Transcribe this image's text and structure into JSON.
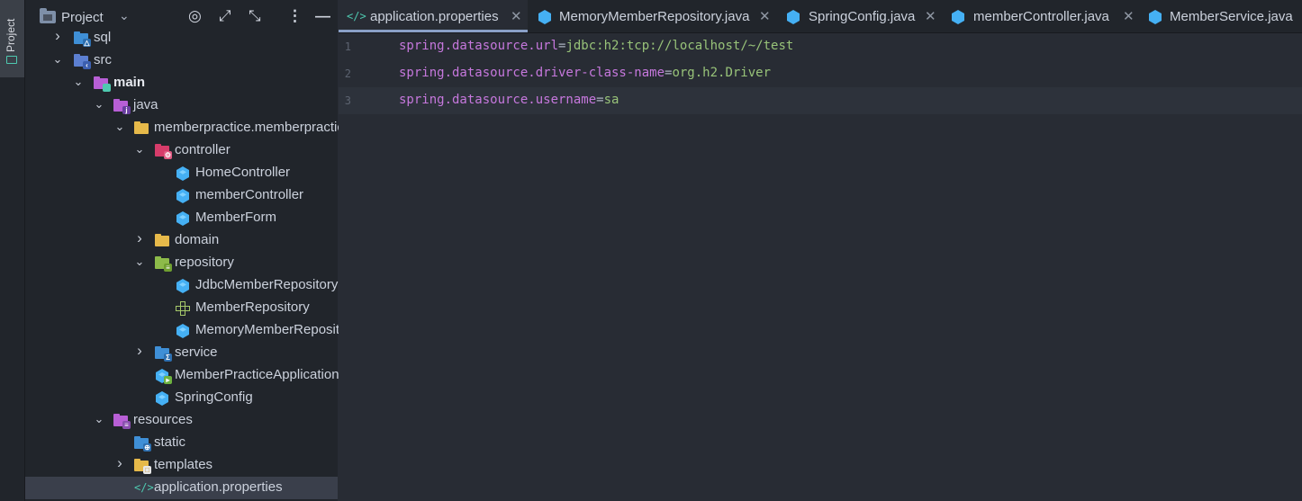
{
  "side_strip": {
    "tab_label": "Project"
  },
  "panel": {
    "title": "Project",
    "tree": [
      {
        "label": "sql",
        "icon": "sql-folder-icon",
        "depth": 1,
        "expanded": false,
        "has_chevron": true
      },
      {
        "label": "src",
        "icon": "source-folder-icon",
        "depth": 1,
        "expanded": true,
        "has_chevron": true
      },
      {
        "label": "main",
        "icon": "module-folder-icon",
        "depth": 2,
        "expanded": true,
        "has_chevron": true,
        "bold": true
      },
      {
        "label": "java",
        "icon": "java-source-folder-icon",
        "depth": 3,
        "expanded": true,
        "has_chevron": true
      },
      {
        "label": "memberpractice.memberpractice",
        "icon": "package-folder-icon",
        "depth": 4,
        "expanded": true,
        "has_chevron": true
      },
      {
        "label": "controller",
        "icon": "controller-package-icon",
        "depth": 5,
        "expanded": true,
        "has_chevron": true
      },
      {
        "label": "HomeController",
        "icon": "java-class-icon",
        "depth": 6,
        "has_chevron": false
      },
      {
        "label": "memberController",
        "icon": "java-class-icon",
        "depth": 6,
        "has_chevron": false
      },
      {
        "label": "MemberForm",
        "icon": "java-class-icon",
        "depth": 6,
        "has_chevron": false
      },
      {
        "label": "domain",
        "icon": "package-folder-icon",
        "depth": 5,
        "expanded": false,
        "has_chevron": true
      },
      {
        "label": "repository",
        "icon": "repository-package-icon",
        "depth": 5,
        "expanded": true,
        "has_chevron": true
      },
      {
        "label": "JdbcMemberRepository",
        "icon": "java-class-icon",
        "depth": 6,
        "has_chevron": false
      },
      {
        "label": "MemberRepository",
        "icon": "interface-icon",
        "depth": 6,
        "has_chevron": false
      },
      {
        "label": "MemoryMemberRepository",
        "icon": "java-class-icon",
        "depth": 6,
        "has_chevron": false
      },
      {
        "label": "service",
        "icon": "service-package-icon",
        "depth": 5,
        "expanded": false,
        "has_chevron": true
      },
      {
        "label": "MemberPracticeApplication",
        "icon": "spring-boot-app-icon",
        "depth": 5,
        "has_chevron": false
      },
      {
        "label": "SpringConfig",
        "icon": "java-class-icon",
        "depth": 5,
        "has_chevron": false
      },
      {
        "label": "resources",
        "icon": "resources-folder-icon",
        "depth": 3,
        "expanded": true,
        "has_chevron": true
      },
      {
        "label": "static",
        "icon": "web-folder-icon",
        "depth": 4,
        "has_chevron": false
      },
      {
        "label": "templates",
        "icon": "templates-folder-icon",
        "depth": 4,
        "expanded": false,
        "has_chevron": true
      },
      {
        "label": "application.properties",
        "icon": "properties-file-icon",
        "depth": 4,
        "has_chevron": false,
        "selected": true
      }
    ]
  },
  "tabs": [
    {
      "label": "application.properties",
      "icon": "properties-file-icon",
      "active": true
    },
    {
      "label": "MemoryMemberRepository.java",
      "icon": "java-class-icon",
      "active": false
    },
    {
      "label": "SpringConfig.java",
      "icon": "java-class-icon",
      "active": false
    },
    {
      "label": "memberController.java",
      "icon": "java-class-icon",
      "active": false
    },
    {
      "label": "MemberService.java",
      "icon": "java-class-icon",
      "active": false
    }
  ],
  "editor": {
    "lines": [
      {
        "number": "1",
        "key": "spring.datasource.url",
        "eq": "=",
        "value": "jdbc:h2:tcp://localhost/~/test"
      },
      {
        "number": "2",
        "key": "spring.datasource.driver-class-name",
        "eq": "=",
        "value": "org.h2.Driver"
      },
      {
        "number": "3",
        "key": "spring.datasource.username",
        "eq": "=",
        "value": "sa",
        "current": true
      }
    ]
  },
  "colors": {
    "editor_bg": "#282c34",
    "panel_bg": "#21252b",
    "property_key": "#c678dd",
    "property_value": "#98c379",
    "class_icon": "#45b0f4",
    "folder_icon": "#e6b94a"
  }
}
